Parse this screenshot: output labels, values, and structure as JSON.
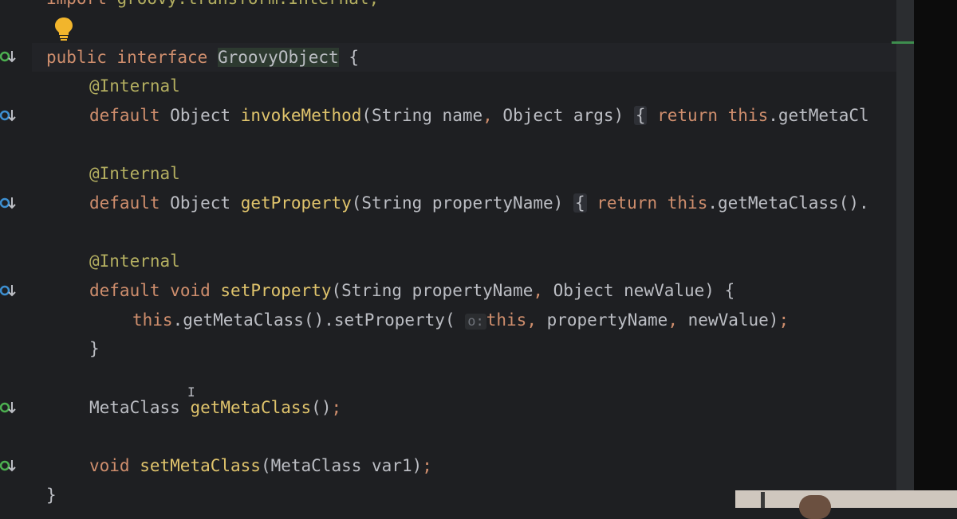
{
  "editor": {
    "lines": {
      "import_kw": "import",
      "import_rest": " groovy.transform.Internal;",
      "l1_public": "public",
      "l1_interface": "interface",
      "l1_class": "GroovyObject",
      "l1_brace": "{",
      "ann1": "@Internal",
      "l2_default": "default",
      "l2_type": "Object",
      "l2_name": "invokeMethod",
      "l2_params": "(String name",
      "l2_comma": ",",
      "l2_params2": " Object args)",
      "l2_fold": "{",
      "l2_return": "return",
      "l2_this": "this",
      "l2_rest": ".getMetaCl",
      "ann2": "@Internal",
      "l3_default": "default",
      "l3_type": "Object",
      "l3_name": "getProperty",
      "l3_params": "(String propertyName)",
      "l3_fold": "{",
      "l3_return": "return",
      "l3_this": "this",
      "l3_rest": ".getMetaClass().",
      "ann3": "@Internal",
      "l4_default": "default",
      "l4_void": "void",
      "l4_name": "setProperty",
      "l4_params": "(String propertyName",
      "l4_comma": ",",
      "l4_params2": " Object newValue) {",
      "l5_this": "this",
      "l5_call": ".getMetaClass().setProperty(",
      "l5_hint": "o:",
      "l5_this2": "this",
      "l5_comma1": ",",
      "l5_arg2": " propertyName",
      "l5_comma2": ",",
      "l5_arg3": " newValue)",
      "l5_semi": ";",
      "l6_close": "}",
      "l7_type": "MetaClass",
      "l7_name": "getMetaClass",
      "l7_rest": "()",
      "l7_semi": ";",
      "l8_void": "void",
      "l8_name": "setMetaClass",
      "l8_params": "(MetaClass var1)",
      "l8_semi": ";",
      "l9_close": "}"
    },
    "icons": {
      "gutter": "implemented-override-icon",
      "bulb": "lightbulb-icon",
      "cursor": "text-cursor-icon"
    },
    "colors": {
      "background": "#1e1f22",
      "keyword": "#cf8e6d",
      "annotation": "#b3ae60",
      "method": "#e0c46c",
      "text": "#bcbec4",
      "gutter_icon": "#3d8fd1"
    }
  }
}
